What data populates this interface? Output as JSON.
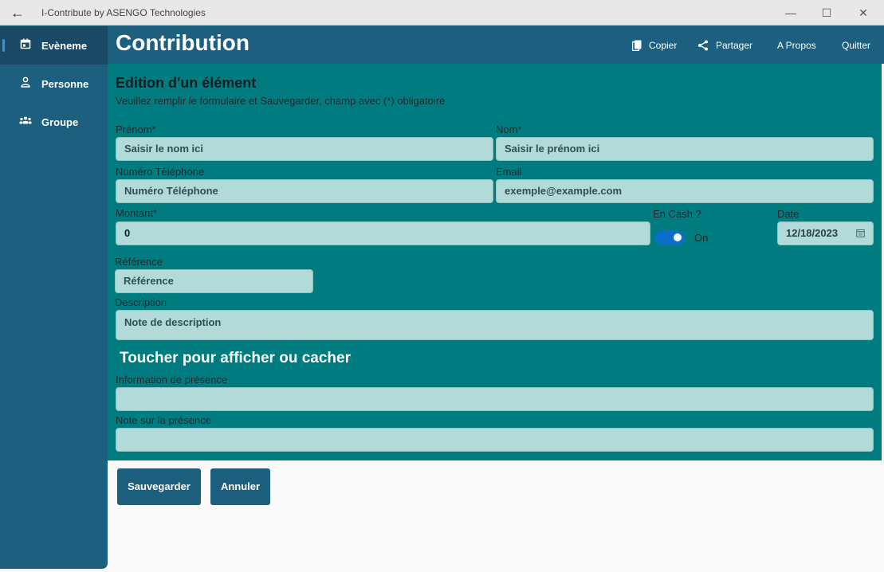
{
  "window": {
    "title": "I-Contribute by ASENGO Technologies",
    "back_glyph": "←",
    "minimize_glyph": "—",
    "maximize_glyph": "☐",
    "close_glyph": "✕"
  },
  "sidebar": {
    "items": [
      {
        "label": "Evèneme",
        "icon": "calendar-icon",
        "active": true
      },
      {
        "label": "Personne",
        "icon": "person-icon",
        "active": false
      },
      {
        "label": "Groupe",
        "icon": "group-icon",
        "active": false
      }
    ]
  },
  "header": {
    "title": "Contribution",
    "actions": [
      {
        "label": "Copier",
        "icon": "copy-icon"
      },
      {
        "label": "Partager",
        "icon": "share-icon"
      },
      {
        "label": "A Propos"
      },
      {
        "label": "Quitter"
      }
    ]
  },
  "form": {
    "heading": "Edition d'un élément",
    "subheading": "Veuillez remplir le formulaire et Sauvegarder, champ avec (*) obligatoire",
    "prenom": {
      "label": "Prénom*",
      "placeholder": "Saisir le nom ici"
    },
    "nom": {
      "label": "Nom*",
      "placeholder": "Saisir le prénom ici"
    },
    "telephone": {
      "label": "Numéro Téléphone",
      "placeholder": "Numéro Téléphone"
    },
    "email": {
      "label": "Email",
      "placeholder": "exemple@example.com"
    },
    "montant": {
      "label": "Montant*",
      "value": "0"
    },
    "en_cash": {
      "label": "En Cash ?",
      "state": "On",
      "on": true
    },
    "date": {
      "label": "Date",
      "value": "12/18/2023"
    },
    "reference": {
      "label": "Référence",
      "placeholder": "Référence"
    },
    "description": {
      "label": "Description",
      "placeholder": "Note de description"
    },
    "toggle_section": "Toucher pour afficher ou cacher",
    "presence_info": {
      "label": "Information de présence",
      "value": ""
    },
    "presence_note": {
      "label": "Note sur la présence",
      "value": ""
    }
  },
  "buttons": {
    "save": "Sauvegarder",
    "cancel": "Annuler"
  },
  "colors": {
    "accent": "#1d5f7e",
    "panel": "#007c80",
    "field": "#b2dad9",
    "toggle": "#0a6ec9"
  }
}
